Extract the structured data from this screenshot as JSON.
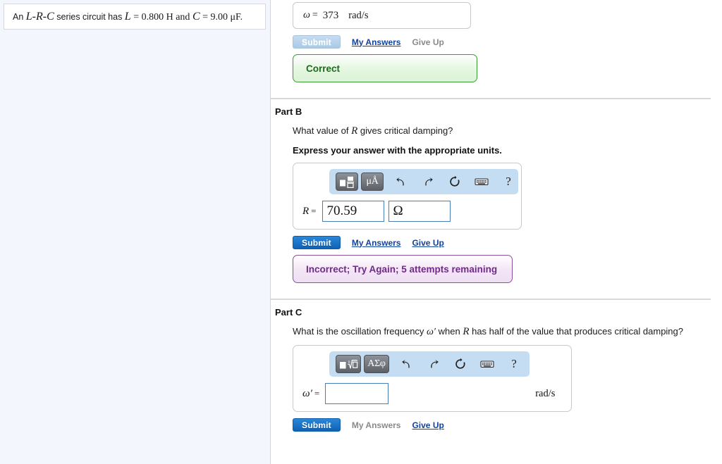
{
  "problem": {
    "text_prefix": "An ",
    "circuit_label": "L-R-C",
    "text_mid": " series circuit has ",
    "inductance_symbol": "L",
    "inductance_eq": " = 0.800  H and ",
    "capacitance_symbol": "C",
    "capacitance_eq": " = 9.00 ",
    "capacitance_unit": "μF."
  },
  "part_a": {
    "variable": "ω",
    "equals": "=",
    "value": "373",
    "unit": "rad/s",
    "submit_label": "Submit",
    "my_answers_label": "My Answers",
    "give_up_label": "Give Up",
    "feedback": "Correct"
  },
  "part_b": {
    "title": "Part B",
    "question_prefix": "What value of ",
    "question_symbol": "R",
    "question_suffix": " gives critical damping?",
    "instruction": "Express your answer with the appropriate units.",
    "toolbar": {
      "template_icon": "fraction-template-icon",
      "units_label": "μÅ",
      "undo_icon": "undo-arrow-icon",
      "redo_icon": "redo-arrow-icon",
      "reset_icon": "reset-circular-arrow-icon",
      "keyboard_icon": "keyboard-icon",
      "help_label": "?"
    },
    "variable": "R",
    "equals": "=",
    "value": "70.59",
    "unit_value": "Ω",
    "submit_label": "Submit",
    "my_answers_label": "My Answers",
    "give_up_label": "Give Up",
    "feedback": "Incorrect; Try Again; 5 attempts remaining"
  },
  "part_c": {
    "title": "Part C",
    "question_prefix": "What is the oscillation frequency ",
    "question_symbol": "ω′",
    "question_mid": " when ",
    "question_symbol2": "R",
    "question_suffix": " has half of the value that produces critical damping?",
    "toolbar": {
      "template_icon": "nth-root-template-icon",
      "greek_label": "ΑΣφ",
      "undo_icon": "undo-arrow-icon",
      "redo_icon": "redo-arrow-icon",
      "reset_icon": "reset-circular-arrow-icon",
      "keyboard_icon": "keyboard-icon",
      "help_label": "?"
    },
    "variable": "ω′",
    "equals": "=",
    "value": "",
    "unit": "rad/s",
    "submit_label": "Submit",
    "my_answers_label": "My Answers",
    "give_up_label": "Give Up"
  },
  "colors": {
    "submit_active": "#0f62b5",
    "submit_disabled": "#aac9e6",
    "link": "#12429b",
    "correct_border": "#3b9b3b",
    "correct_text": "#1c6b1c",
    "incorrect_border": "#8b4f9e",
    "incorrect_text": "#6f2b85",
    "toolbar_bg": "#c5ddf2",
    "input_border": "#4a7ebb",
    "left_panel_bg": "#f3f7fd"
  }
}
